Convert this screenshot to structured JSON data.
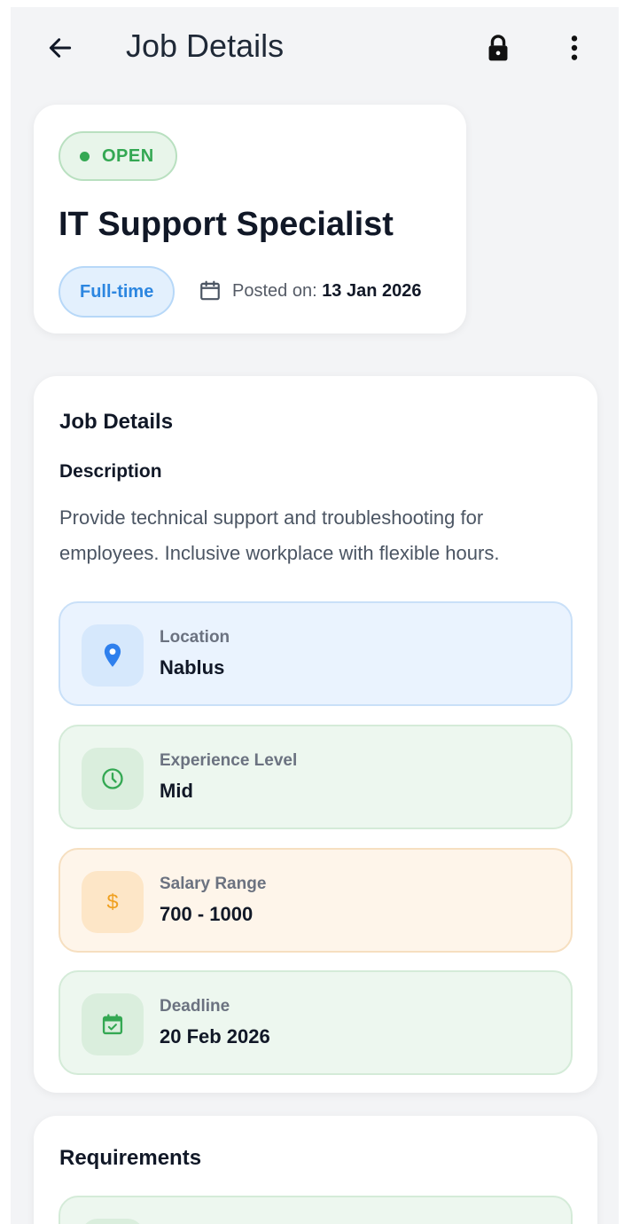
{
  "app_bar": {
    "title": "Job Details",
    "back_icon": "arrow-left-icon",
    "lock_icon": "lock-icon",
    "more_icon": "more-vertical-icon"
  },
  "job": {
    "status": "OPEN",
    "title": "IT Support Specialist",
    "employment_type": "Full-time",
    "posted_label": "Posted on:",
    "posted_date": "13 Jan 2026"
  },
  "details": {
    "heading": "Job Details",
    "description_heading": "Description",
    "description": "Provide technical support and troubleshooting for employees. Inclusive workplace with flexible hours.",
    "items": [
      {
        "label": "Location",
        "value": "Nablus",
        "icon": "location-pin-icon",
        "color": "#2f80ed"
      },
      {
        "label": "Experience Level",
        "value": "Mid",
        "icon": "clock-icon",
        "color": "#34a853"
      },
      {
        "label": "Salary Range",
        "value": "700 - 1000",
        "icon": "dollar-icon",
        "color": "#f0a020"
      },
      {
        "label": "Deadline",
        "value": "20 Feb 2026",
        "icon": "calendar-check-icon",
        "color": "#34a853"
      }
    ]
  },
  "requirements": {
    "heading": "Requirements"
  },
  "colors": {
    "open_green": "#34a853",
    "chip_blue": "#2c86e0",
    "background": "#f3f4f6"
  }
}
